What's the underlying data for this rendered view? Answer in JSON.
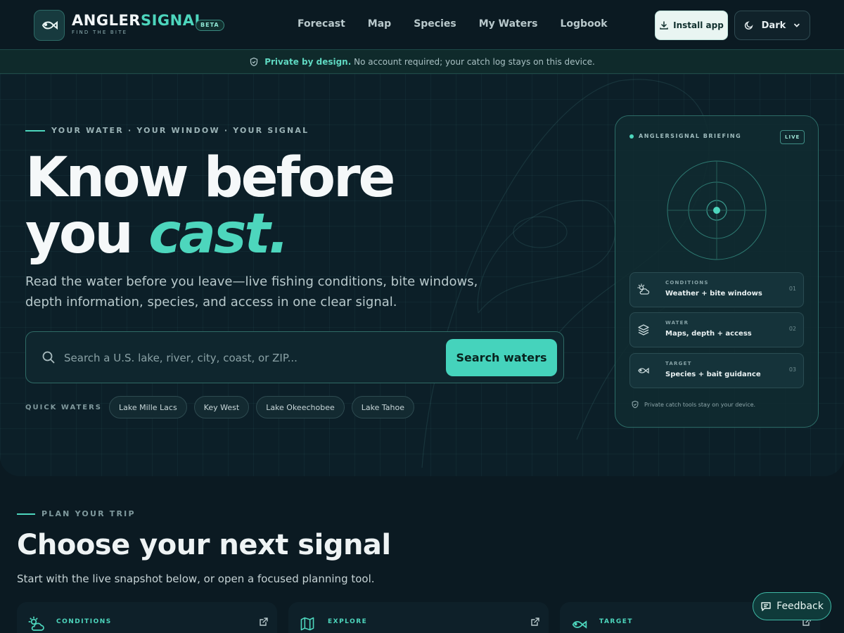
{
  "brand": {
    "name_part1": "ANGLER",
    "name_part2": "SIGNAL",
    "tagline": "FIND THE BITE",
    "badge": "BETA"
  },
  "nav": {
    "items": [
      "Forecast",
      "Map",
      "Species",
      "My Waters",
      "Logbook"
    ]
  },
  "header": {
    "install_label": "Install app",
    "theme_label": "Dark"
  },
  "banner": {
    "strong": "Private by design.",
    "text": "No account required; your catch log stays on this device."
  },
  "hero": {
    "eyebrow": "YOUR WATER · YOUR WINDOW · YOUR SIGNAL",
    "title_line1": "Know before",
    "title_line2_plain": "you ",
    "title_line2_accent": "cast.",
    "lede": "Read the water before you leave—live fishing conditions, bite windows, depth information, species, and access in one clear signal.",
    "search_placeholder": "Search a U.S. lake, river, city, coast, or ZIP...",
    "search_button": "Search waters",
    "quick_label": "QUICK WATERS",
    "quick_waters": [
      "Lake Mille Lacs",
      "Key West",
      "Lake Okeechobee",
      "Lake Tahoe"
    ]
  },
  "briefing": {
    "title": "ANGLERSIGNAL BRIEFING",
    "status": "LIVE",
    "rows": [
      {
        "kicker": "CONDITIONS",
        "title": "Weather + bite windows",
        "num": "01",
        "icon": "cloud-sun-icon"
      },
      {
        "kicker": "WATER",
        "title": "Maps, depth + access",
        "num": "02",
        "icon": "layers-icon"
      },
      {
        "kicker": "TARGET",
        "title": "Species + bait guidance",
        "num": "03",
        "icon": "fish-icon"
      }
    ],
    "footer": "Private catch tools stay on your device."
  },
  "plan": {
    "eyebrow": "PLAN YOUR TRIP",
    "title": "Choose your next signal",
    "subtitle": "Start with the live snapshot below, or open a focused planning tool.",
    "cards": [
      {
        "kicker": "CONDITIONS",
        "icon": "cloud-sun-icon"
      },
      {
        "kicker": "EXPLORE",
        "icon": "map-icon"
      },
      {
        "kicker": "TARGET",
        "icon": "fish-icon"
      }
    ]
  },
  "feedback": {
    "label": "Feedback"
  },
  "colors": {
    "accent": "#4dd6bd",
    "background": "#0b1a22",
    "hero": "#0c1f28"
  }
}
